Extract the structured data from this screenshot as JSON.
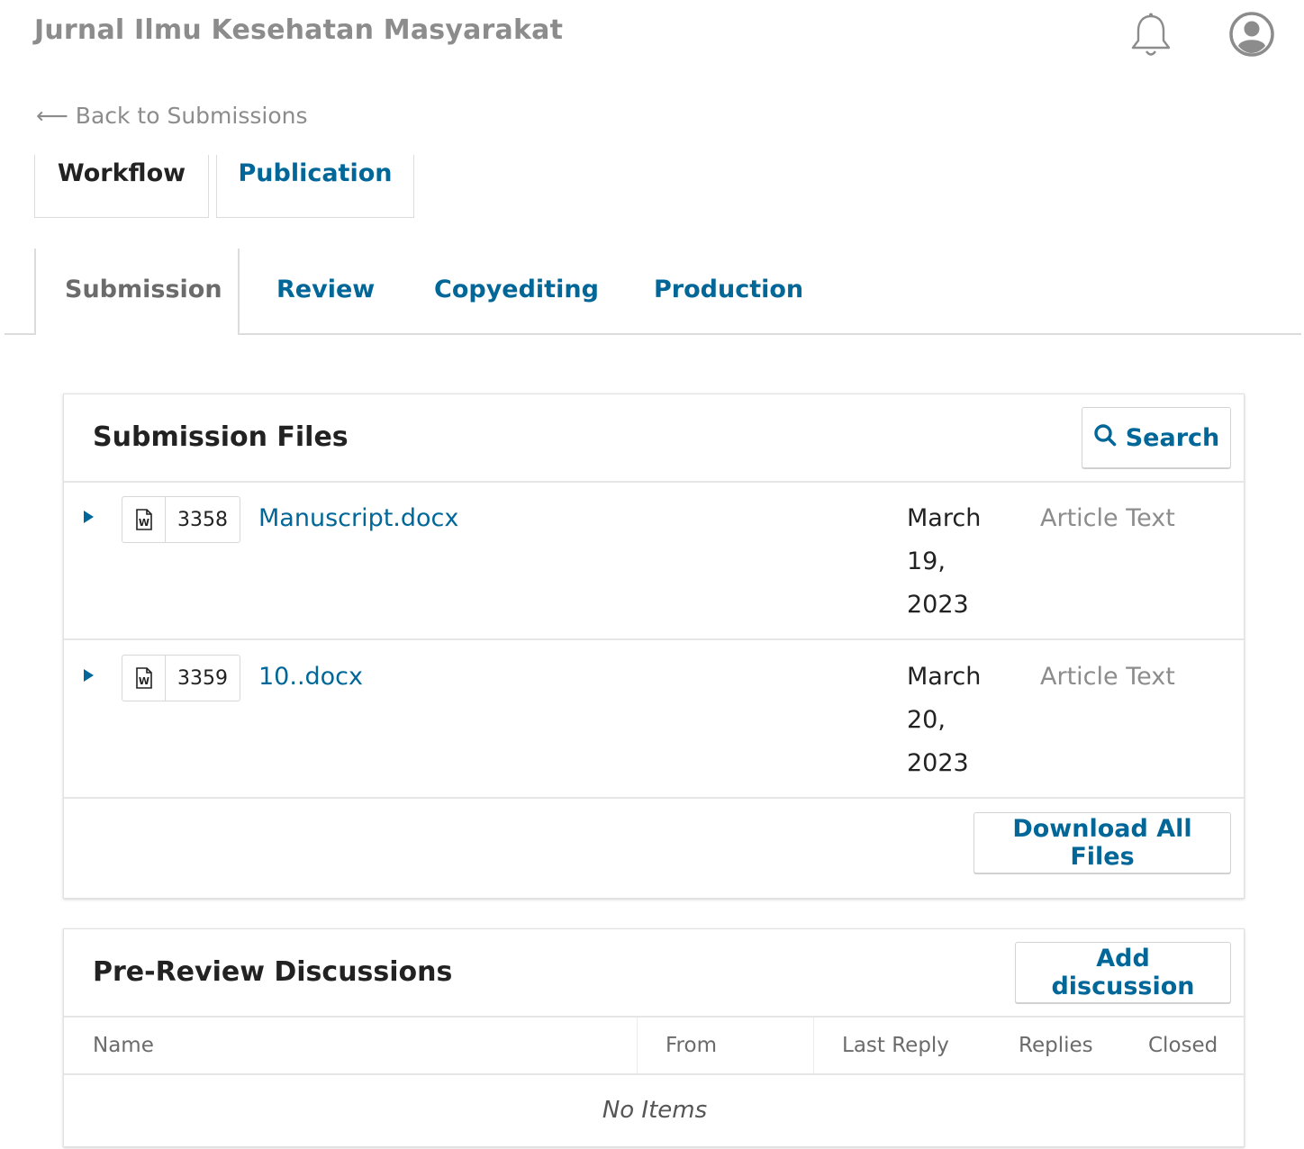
{
  "header": {
    "journal_title": "Jurnal Ilmu Kesehatan Masyarakat",
    "notifications_icon": "bell-icon",
    "user_icon": "user-circle-icon"
  },
  "back_link": "⟵ Back to Submissions",
  "top_tabs": [
    {
      "label": "Workflow",
      "active": true
    },
    {
      "label": "Publication",
      "active": false
    }
  ],
  "stage_tabs": [
    {
      "label": "Submission",
      "active": true
    },
    {
      "label": "Review",
      "active": false
    },
    {
      "label": "Copyediting",
      "active": false
    },
    {
      "label": "Production",
      "active": false
    }
  ],
  "submission_files": {
    "title": "Submission Files",
    "search_label": "Search",
    "search_icon": "search-icon",
    "files": [
      {
        "id": "3358",
        "name": "Manuscript.docx",
        "date": "March 19, 2023",
        "type": "Article Text",
        "icon": "word-file-icon"
      },
      {
        "id": "3359",
        "name": "10..docx",
        "date": "March 20, 2023",
        "type": "Article Text",
        "icon": "word-file-icon"
      }
    ],
    "download_all_label": "Download All Files"
  },
  "discussions": {
    "title": "Pre-Review Discussions",
    "add_label": "Add discussion",
    "columns": [
      "Name",
      "From",
      "Last Reply",
      "Replies",
      "Closed"
    ],
    "empty_text": "No Items"
  },
  "colors": {
    "link": "#006798",
    "muted": "#8c8c8c",
    "border": "#dcdcdc"
  }
}
